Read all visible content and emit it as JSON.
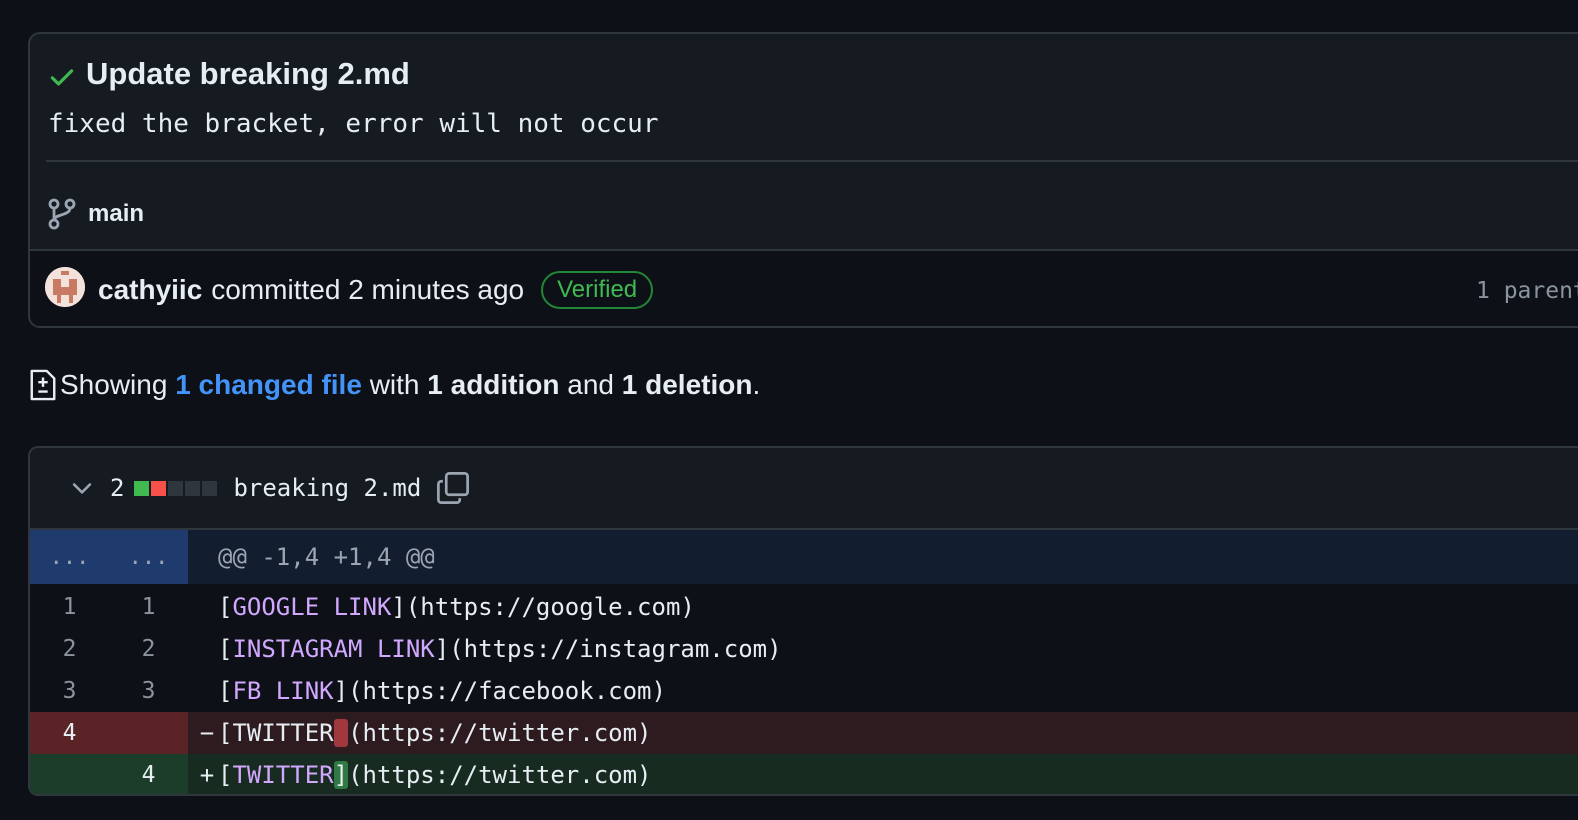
{
  "commit": {
    "title": "Update breaking 2.md",
    "description": "fixed the bracket, error will not occur",
    "branch": "main",
    "author": "cathyiic",
    "committed_text": "committed 2 minutes ago",
    "verified_label": "Verified",
    "parent_text": "1 parent"
  },
  "summary": {
    "prefix": "Showing",
    "changed_link": "1 changed file",
    "with": "with",
    "additions": "1 addition",
    "and": "and",
    "deletions": "1 deletion",
    "suffix": "."
  },
  "file": {
    "change_count": "2",
    "name": "breaking 2.md",
    "hunk_left": "...",
    "hunk_right": "...",
    "hunk_header": "@@ -1,4 +1,4 @@",
    "lines": [
      {
        "old": "1",
        "new": "1",
        "marker": "",
        "open": "[",
        "kw": "GOOGLE LINK",
        "close": "]",
        "rest": "(https://google.com)"
      },
      {
        "old": "2",
        "new": "2",
        "marker": "",
        "open": "[",
        "kw": "INSTAGRAM LINK",
        "close": "]",
        "rest": "(https://instagram.com)"
      },
      {
        "old": "3",
        "new": "3",
        "marker": "",
        "open": "[",
        "kw": "FB LINK",
        "close": "]",
        "rest": "(https://facebook.com)"
      },
      {
        "old": "4",
        "new": "",
        "marker": "−",
        "open": "[",
        "kw": "TWITTER",
        "close": "",
        "rest": "(https://twitter.com)"
      },
      {
        "old": "",
        "new": "4",
        "marker": "+",
        "open": "[",
        "kw": "TWITTER",
        "close": "]",
        "rest": "(https://twitter.com)"
      }
    ]
  },
  "colors": {
    "background": "#0d1117",
    "verified": "#3fb950",
    "link": "#4493f8",
    "deletion": "#a0383e",
    "addition": "#2e7a42"
  }
}
